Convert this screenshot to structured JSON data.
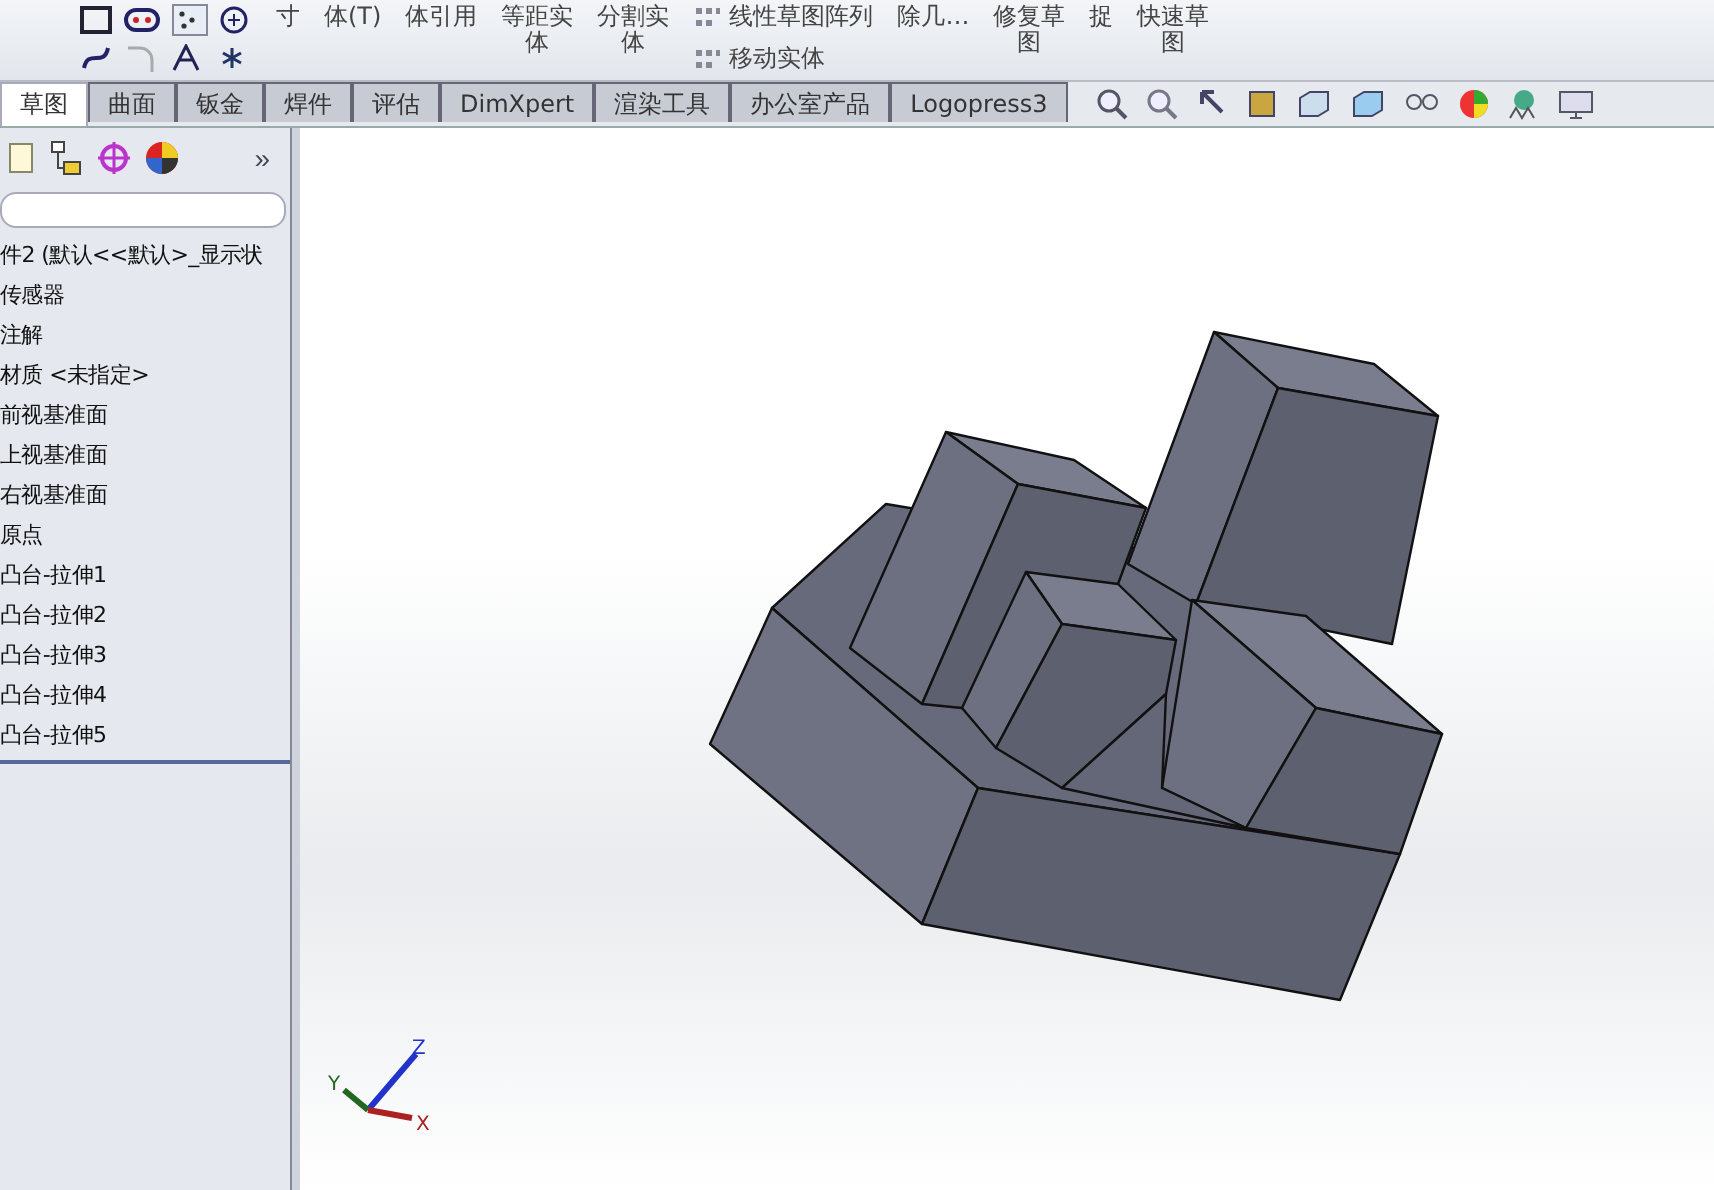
{
  "toolbar": {
    "buttons": [
      {
        "lines": [
          "寸"
        ]
      },
      {
        "lines": [
          "体(T)"
        ]
      },
      {
        "lines": [
          "体引用"
        ]
      },
      {
        "lines": [
          "等距实",
          "体"
        ]
      },
      {
        "lines": [
          "分割实",
          "体"
        ]
      },
      {
        "lines": [
          "除几…"
        ]
      },
      {
        "lines": [
          "修复草",
          "图"
        ]
      },
      {
        "lines": [
          "捉"
        ]
      },
      {
        "lines": [
          "快速草",
          "图"
        ]
      }
    ],
    "pattern_items": [
      "线性草图阵列",
      "移动实体"
    ]
  },
  "tabs": [
    {
      "label": "草图",
      "selected": true
    },
    {
      "label": "曲面",
      "selected": false
    },
    {
      "label": "钣金",
      "selected": false
    },
    {
      "label": "焊件",
      "selected": false
    },
    {
      "label": "评估",
      "selected": false
    },
    {
      "label": "DimXpert",
      "selected": false
    },
    {
      "label": "渲染工具",
      "selected": false
    },
    {
      "label": "办公室产品",
      "selected": false
    },
    {
      "label": "Logopress3",
      "selected": false
    }
  ],
  "panel": {
    "more": "»",
    "tree": [
      {
        "label": "件2 (默认<<默认>_显示状"
      },
      {
        "label": "传感器"
      },
      {
        "label": "注解"
      },
      {
        "label": "材质 <未指定>"
      },
      {
        "label": "前视基准面"
      },
      {
        "label": "上视基准面"
      },
      {
        "label": "右视基准面"
      },
      {
        "label": "原点"
      },
      {
        "label": "凸台-拉伸1"
      },
      {
        "label": "凸台-拉伸2"
      },
      {
        "label": "凸台-拉伸3"
      },
      {
        "label": "凸台-拉伸4"
      },
      {
        "label": "凸台-拉伸5"
      }
    ]
  },
  "triad": {
    "x": "X",
    "y": "Y",
    "z": "Z"
  }
}
